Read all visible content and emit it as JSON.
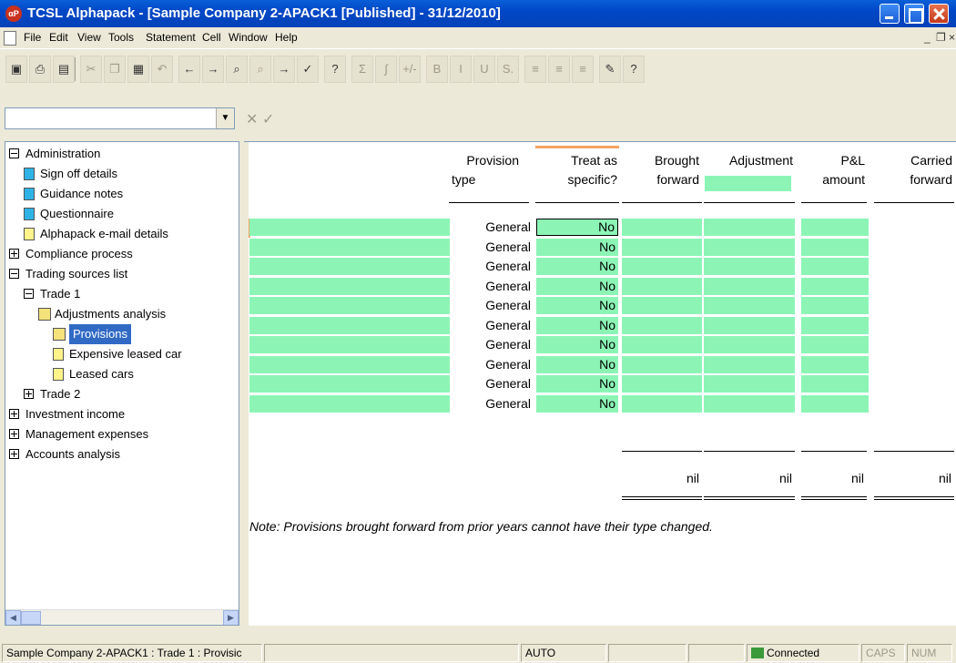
{
  "window": {
    "icon_text": "αP",
    "title": "TCSL Alphapack - [Sample Company 2-APACK1 [Published] - 31/12/2010]"
  },
  "menu": [
    "File",
    "Edit",
    "View",
    "Tools",
    "Statement",
    "Cell",
    "Window",
    "Help"
  ],
  "mdi_controls": {
    "minimize": "_",
    "restore": "❐",
    "close": "×"
  },
  "toolbar": [
    {
      "name": "save-icon",
      "glyph": "▣"
    },
    {
      "name": "print-icon",
      "glyph": "⎙"
    },
    {
      "name": "print-preview-icon",
      "glyph": "▤"
    },
    {
      "name": "cut-icon",
      "glyph": "✂"
    },
    {
      "name": "copy-icon",
      "glyph": "❐"
    },
    {
      "name": "paste-icon",
      "glyph": "▦"
    },
    {
      "name": "undo-icon",
      "glyph": "↶"
    },
    {
      "name": "back-icon",
      "glyph": "←"
    },
    {
      "name": "forward-icon",
      "glyph": "→"
    },
    {
      "name": "find-icon",
      "glyph": "⌕"
    },
    {
      "name": "find-next-icon",
      "glyph": "⌕"
    },
    {
      "name": "goto-icon",
      "glyph": "→"
    },
    {
      "name": "spellcheck-icon",
      "glyph": "✓"
    },
    {
      "name": "help-icon",
      "glyph": "?"
    },
    {
      "name": "sum-icon",
      "glyph": "Σ"
    },
    {
      "name": "formula-icon",
      "glyph": "∫"
    },
    {
      "name": "plus-minus-icon",
      "glyph": "+/-"
    },
    {
      "name": "bold-icon",
      "glyph": "B"
    },
    {
      "name": "italic-icon",
      "glyph": "I"
    },
    {
      "name": "underline-icon",
      "glyph": "U"
    },
    {
      "name": "s-format-icon",
      "glyph": "S."
    },
    {
      "name": "align-left-icon",
      "glyph": "≡"
    },
    {
      "name": "align-center-icon",
      "glyph": "≡"
    },
    {
      "name": "align-right-icon",
      "glyph": "≡"
    },
    {
      "name": "notes-icon",
      "glyph": "✎"
    },
    {
      "name": "context-help-icon",
      "glyph": "?"
    }
  ],
  "cell_edit": {
    "value": "",
    "cancel": "✕",
    "accept": "✓"
  },
  "tree": [
    {
      "label": "Administration",
      "expander": "minus"
    },
    {
      "label": "Sign off details",
      "icon": "blue"
    },
    {
      "label": "Guidance notes",
      "icon": "blue"
    },
    {
      "label": "Questionnaire",
      "icon": "blue"
    },
    {
      "label": "Alphapack e-mail details",
      "icon": "yellow"
    },
    {
      "label": "Compliance process",
      "expander": "plus"
    },
    {
      "label": "Trading sources list",
      "expander": "minus"
    },
    {
      "label": "Trade 1",
      "expander": "minus"
    },
    {
      "label": "Adjustments analysis",
      "icon": "folder"
    },
    {
      "label": "Provisions",
      "icon": "folder-plus",
      "selected": true
    },
    {
      "label": "Expensive leased car",
      "icon": "yellow"
    },
    {
      "label": "Leased cars",
      "icon": "yellow"
    },
    {
      "label": "Trade 2",
      "expander": "plus"
    },
    {
      "label": "Investment income",
      "expander": "plus"
    },
    {
      "label": "Management expenses",
      "expander": "plus"
    },
    {
      "label": "Accounts analysis",
      "expander": "plus"
    }
  ],
  "grid": {
    "headers": {
      "provision_type": [
        "Provision",
        "type"
      ],
      "treat_as_specific": [
        "Treat as",
        "specific?"
      ],
      "brought_forward": [
        "Brought",
        "forward"
      ],
      "adjustment": "Adjustment",
      "pl_amount": [
        "P&L",
        "amount"
      ],
      "carried_forward": [
        "Carried",
        "forward"
      ]
    },
    "rows": [
      {
        "type": "General",
        "specific": "No"
      },
      {
        "type": "General",
        "specific": "No"
      },
      {
        "type": "General",
        "specific": "No"
      },
      {
        "type": "General",
        "specific": "No"
      },
      {
        "type": "General",
        "specific": "No"
      },
      {
        "type": "General",
        "specific": "No"
      },
      {
        "type": "General",
        "specific": "No"
      },
      {
        "type": "General",
        "specific": "No"
      },
      {
        "type": "General",
        "specific": "No"
      },
      {
        "type": "General",
        "specific": "No"
      }
    ],
    "totals": [
      "nil",
      "nil",
      "nil",
      "nil"
    ],
    "note": "Note: Provisions brought forward from prior years cannot have their type changed."
  },
  "status": {
    "path": "Sample Company 2-APACK1 : Trade 1 : Provisic",
    "mode": "AUTO",
    "connection": "Connected",
    "caps": "CAPS",
    "num": "NUM"
  }
}
